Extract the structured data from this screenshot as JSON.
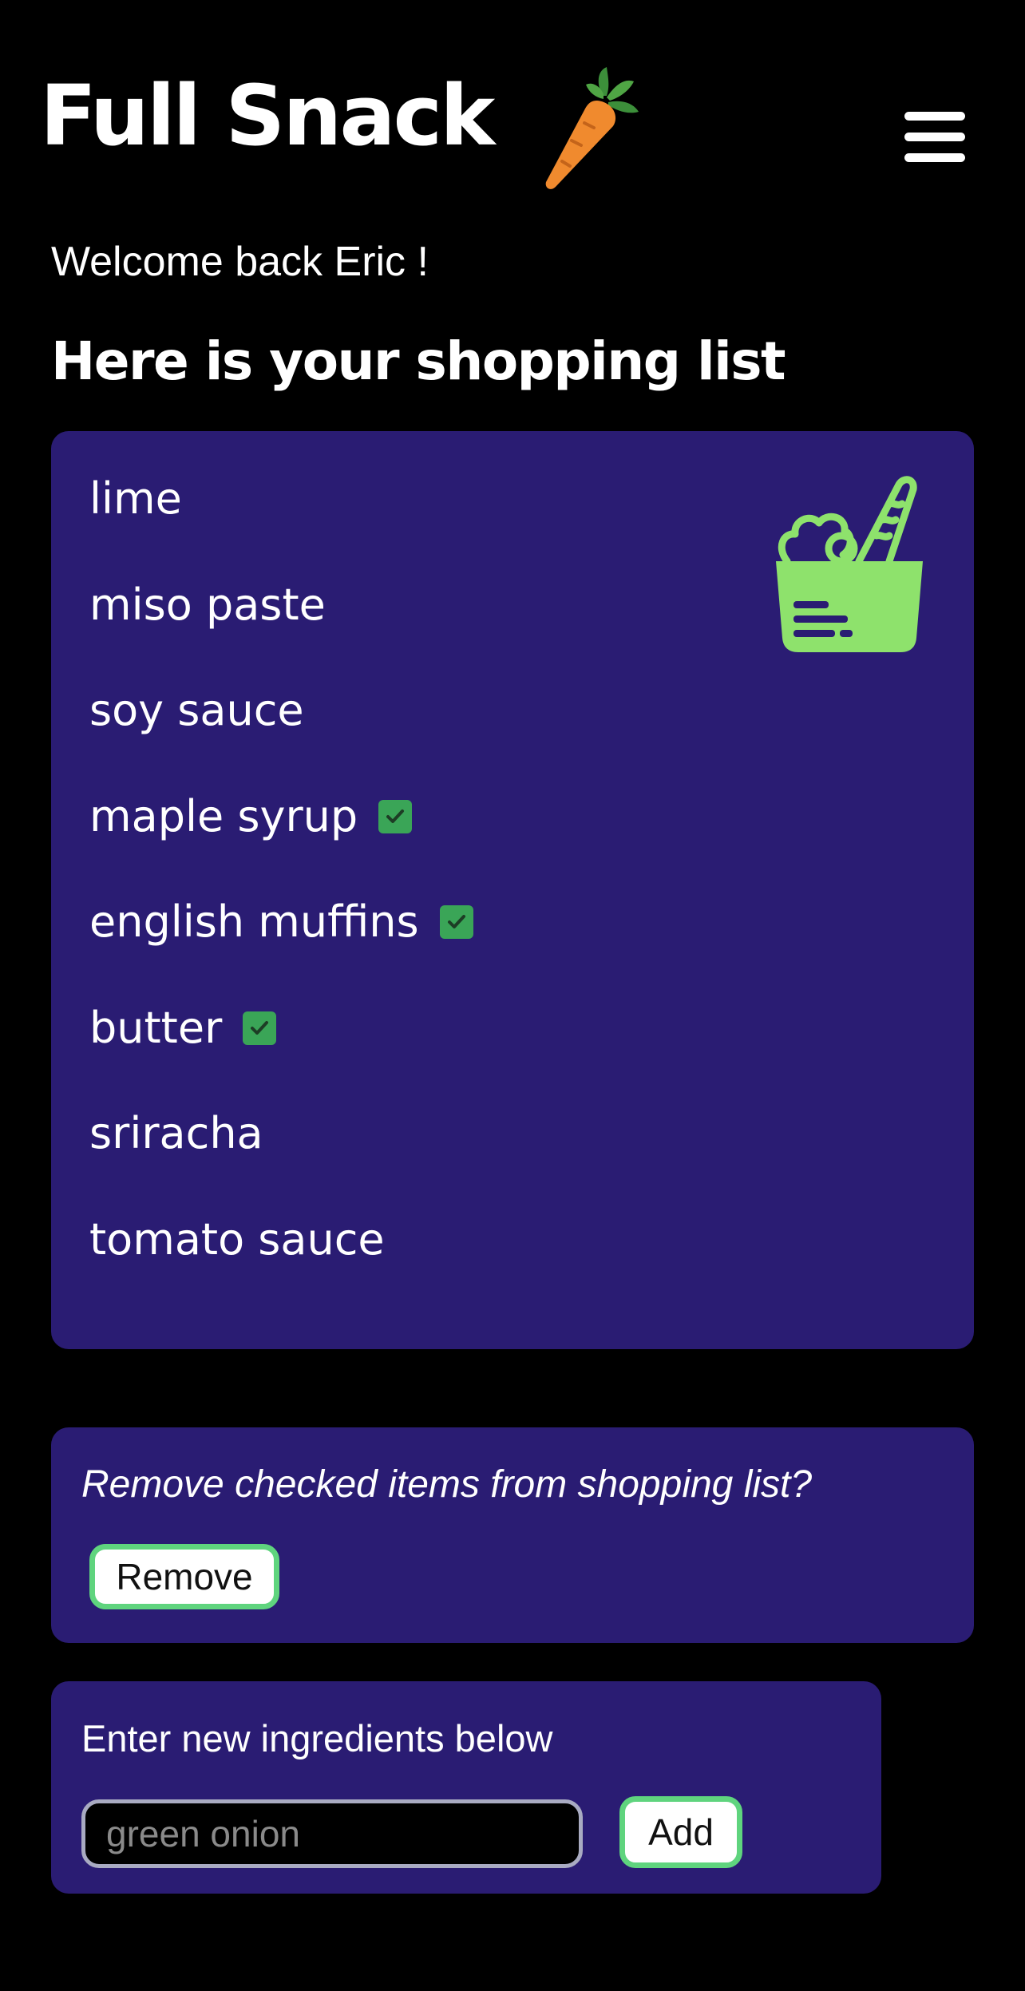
{
  "header": {
    "title": "Full Snack",
    "logo_icon": "carrot-icon",
    "menu_icon": "hamburger-menu-icon"
  },
  "welcome": "Welcome back Eric !",
  "list_heading": "Here is your shopping list",
  "shopping_list": {
    "decoration_icon": "grocery-bag-icon",
    "items": [
      {
        "name": "lime",
        "checked": false
      },
      {
        "name": "miso paste",
        "checked": false
      },
      {
        "name": "soy sauce",
        "checked": false
      },
      {
        "name": "maple syrup",
        "checked": true
      },
      {
        "name": "english muffins",
        "checked": true
      },
      {
        "name": "butter",
        "checked": true
      },
      {
        "name": "sriracha",
        "checked": false
      },
      {
        "name": "tomato sauce",
        "checked": false
      }
    ]
  },
  "remove_section": {
    "prompt": "Remove checked items from shopping list?",
    "button_label": "Remove"
  },
  "add_section": {
    "prompt": "Enter new ingredients below",
    "input_placeholder": "green onion",
    "input_value": "",
    "button_label": "Add"
  },
  "colors": {
    "background": "#000000",
    "card": "#2a1c73",
    "accent_green": "#5fd47e",
    "check_green": "#3aa557",
    "icon_green": "#8ee26c",
    "carrot_orange": "#f08a2e"
  }
}
